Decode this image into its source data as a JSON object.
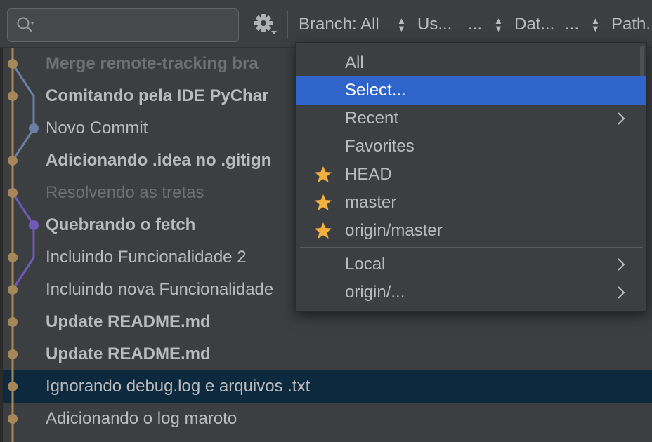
{
  "toolbar": {
    "search": {
      "value": "",
      "placeholder": ""
    },
    "filters": {
      "branch": "Branch: All",
      "user": "Us...",
      "user_ellipsis": "...",
      "date": "Dat...",
      "date_ellipsis": "...",
      "path": "Path..."
    }
  },
  "commits": [
    {
      "message": "Merge remote-tracking bra",
      "style": "dimbold"
    },
    {
      "message": "Comitando pela IDE PyChar",
      "style": "bold"
    },
    {
      "message": "Novo Commit",
      "style": "normal"
    },
    {
      "message": "Adicionando .idea no .gitign",
      "style": "bold"
    },
    {
      "message": "Resolvendo as tretas",
      "style": "dim"
    },
    {
      "message": "Quebrando o fetch",
      "style": "bold"
    },
    {
      "message": "Incluindo Funcionalidade 2",
      "style": "normal"
    },
    {
      "message": "Incluindo nova Funcionalidade",
      "style": "normal"
    },
    {
      "message": "Update README.md",
      "style": "bold"
    },
    {
      "message": "Update README.md",
      "style": "bold"
    },
    {
      "message": "Ignorando debug.log e arquivos .txt",
      "style": "normal",
      "selected": true
    },
    {
      "message": "Adicionando o log maroto",
      "style": "normal"
    }
  ],
  "branch_menu": {
    "items": [
      {
        "label": "All"
      },
      {
        "label": "Select...",
        "highlighted": true
      },
      {
        "label": "Recent",
        "submenu": true
      },
      {
        "label": "Favorites"
      },
      {
        "label": "HEAD",
        "favorite": true
      },
      {
        "label": "master",
        "favorite": true
      },
      {
        "label": "origin/master",
        "favorite": true
      },
      {
        "label": "Local",
        "submenu": true
      },
      {
        "label": "origin/...",
        "submenu": true
      }
    ]
  },
  "colors": {
    "accent": "#2f65ca",
    "star": "#f4af3d",
    "graph_main": "#a7875a",
    "graph_blue": "#6c7fa6",
    "graph_purple": "#7059b8",
    "selected_row": "#0d293e"
  }
}
